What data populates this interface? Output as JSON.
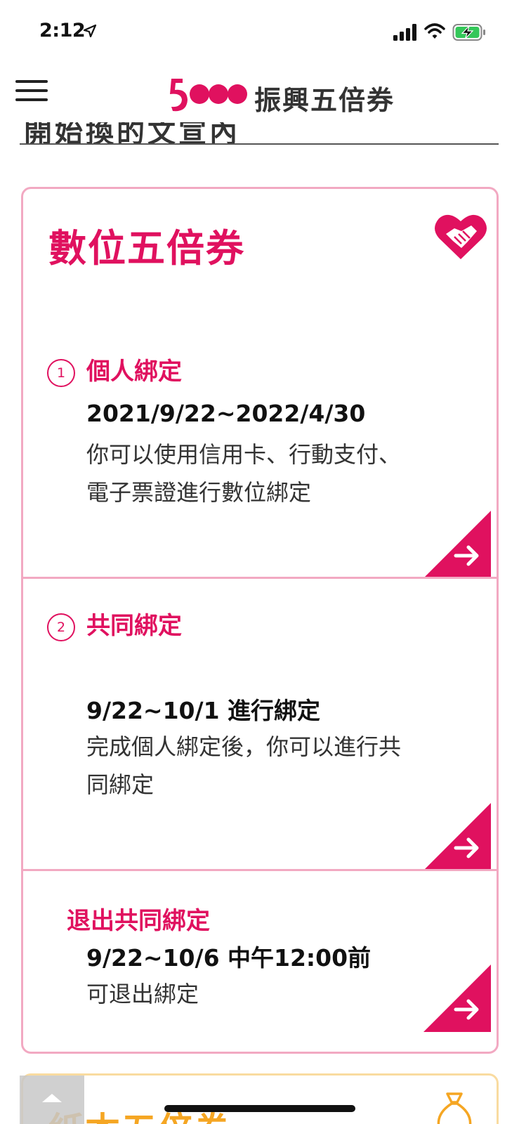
{
  "status_bar": {
    "time": "2:12"
  },
  "header": {
    "brand_text": "振興五倍券"
  },
  "previous_section": {
    "heading_fragment": "開始換的文宣內"
  },
  "digital_card": {
    "title": "數位五倍券",
    "steps": [
      {
        "number": "1",
        "title": "個人綁定",
        "date": "2021/9/22~2022/4/30",
        "description_line1": "你可以使用信用卡、行動支付、",
        "description_line2": "電子票證進行數位綁定"
      },
      {
        "number": "2",
        "title": "共同綁定",
        "date": "9/22~10/1 進行綁定",
        "description_line1": "完成個人綁定後，你可以進行共",
        "description_line2": "同綁定"
      },
      {
        "title": "退出共同綁定",
        "date": "9/22~10/6 中午12:00前",
        "description_line1": "可退出綁定"
      }
    ]
  },
  "paper_card": {
    "title": "紙本五倍券"
  },
  "colors": {
    "accent": "#e0115f",
    "card_border": "#f2a9c2",
    "paper_accent": "#f5a623"
  }
}
